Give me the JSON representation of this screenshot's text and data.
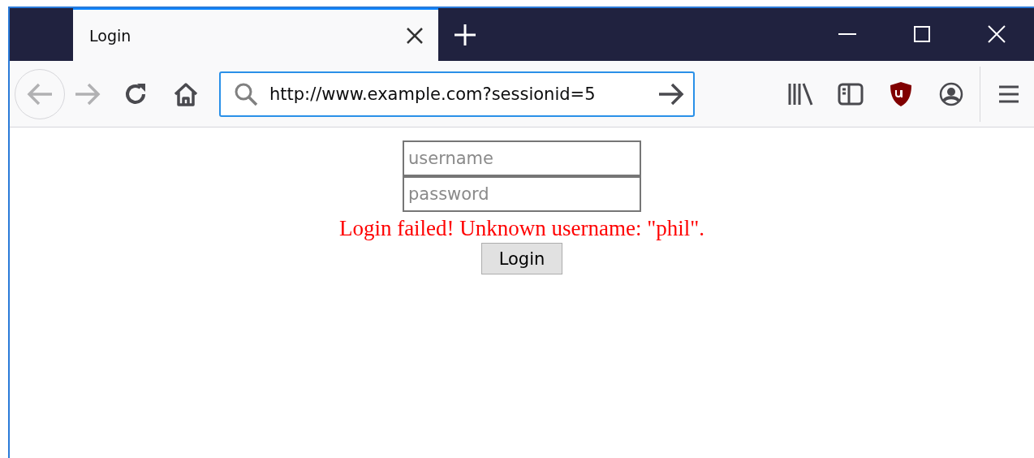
{
  "tabs": [
    {
      "title": "Login",
      "selected": true
    }
  ],
  "address_bar": {
    "url": "http://www.example.com?sessionid=5"
  },
  "form": {
    "username": {
      "placeholder": "username"
    },
    "password": {
      "placeholder": "password"
    },
    "error": "Login failed! Unknown username: \"phil\".",
    "button": "Login"
  }
}
